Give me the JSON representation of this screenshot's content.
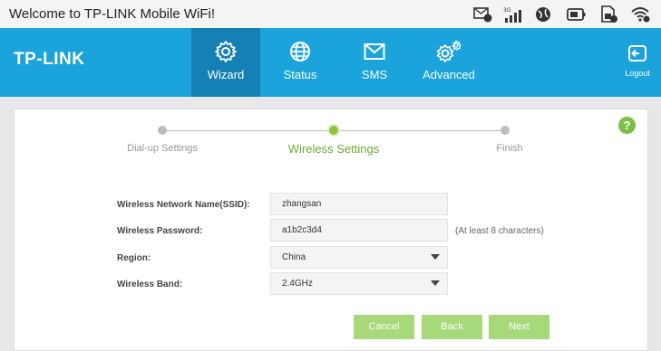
{
  "status_bar": {
    "title": "Welcome to TP-LINK Mobile WiFi!",
    "icons": [
      "message-icon",
      "signal-3g-icon",
      "globe-icon",
      "battery-icon",
      "sim-card-icon",
      "wifi-icon"
    ],
    "signal_label": "3G"
  },
  "header": {
    "logo": "TP-LINK",
    "brand_color": "#1ba3db",
    "nav": [
      {
        "label": "Wizard",
        "icon": "gear-icon",
        "active": true
      },
      {
        "label": "Status",
        "icon": "globe-icon",
        "active": false
      },
      {
        "label": "SMS",
        "icon": "envelope-icon",
        "active": false
      },
      {
        "label": "Advanced",
        "icon": "gears-icon",
        "active": false
      }
    ],
    "logout_label": "Logout"
  },
  "help_label": "?",
  "steps": [
    {
      "label": "Dial-up Settings",
      "state": "done"
    },
    {
      "label": "Wireless Settings",
      "state": "current"
    },
    {
      "label": "Finish",
      "state": "pending"
    }
  ],
  "form": {
    "ssid_label": "Wireless Network Name(SSID):",
    "ssid_value": "zhangsan",
    "password_label": "Wireless Password:",
    "password_value": "a1b2c3d4",
    "password_hint": "(At least 8 characters)",
    "region_label": "Region:",
    "region_value": "China",
    "band_label": "Wireless Band:",
    "band_value": "2.4GHz"
  },
  "buttons": {
    "cancel": "Cancel",
    "back": "Back",
    "next": "Next"
  }
}
